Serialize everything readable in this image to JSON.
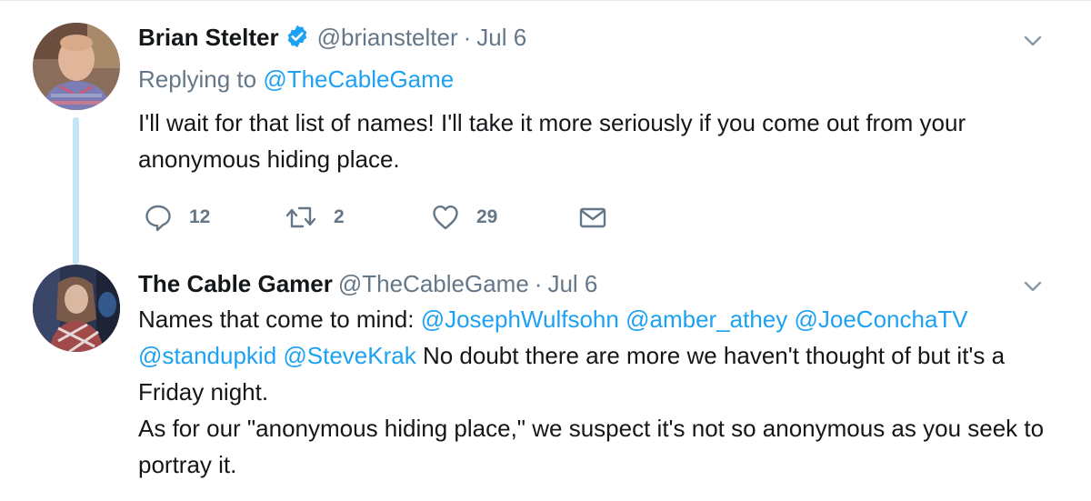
{
  "tweets": [
    {
      "author_name": "Brian Stelter",
      "verified": true,
      "handle": "@brianstelter",
      "separator": "·",
      "date": "Jul 6",
      "replying_prefix": "Replying to",
      "replying_to": "@TheCableGame",
      "text": "I'll wait for that list of names! I'll take it more seriously if you come out from your anonymous hiding place.",
      "actions": {
        "reply_count": "12",
        "retweet_count": "2",
        "like_count": "29"
      }
    },
    {
      "author_name": "The Cable Gamer",
      "handle": "@TheCableGame",
      "separator": "·",
      "date": "Jul 6",
      "intro": "Names that come to mind:",
      "mentions": [
        "@JosephWulfsohn",
        "@amber_athey",
        "@JoeConchaTV",
        "@standupkid",
        "@SteveKrak"
      ],
      "text_after_mentions": "No doubt there are more we haven't thought of but it's a Friday night.",
      "paragraph2": "As for our \"anonymous hiding place,\" we suspect it's not so anonymous as you seek to portray it."
    }
  ],
  "icons": [
    "verified-badge-icon",
    "chevron-down-icon",
    "reply-icon",
    "retweet-icon",
    "heart-icon",
    "envelope-icon"
  ],
  "colors": {
    "link": "#1da1f2",
    "secondary_text": "#657786",
    "primary_text": "#14171a",
    "thread_line": "#c4e4f8"
  }
}
